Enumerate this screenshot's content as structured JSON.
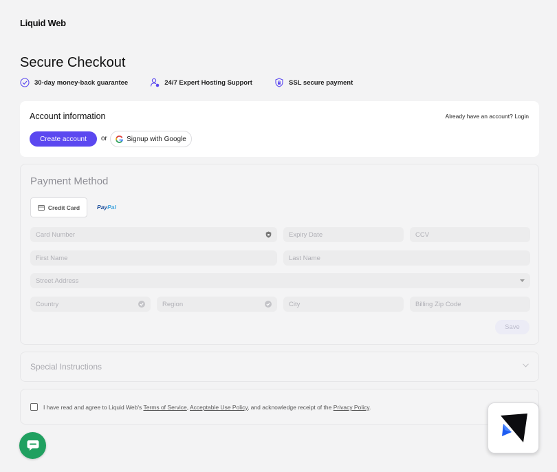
{
  "brand": {
    "logo": "Liquid Web"
  },
  "page": {
    "title": "Secure Checkout"
  },
  "badges": [
    {
      "icon": "check-circle-icon",
      "label": "30-day money-back guarantee"
    },
    {
      "icon": "support-agent-icon",
      "label": "24/7 Expert Hosting Support"
    },
    {
      "icon": "shield-lock-icon",
      "label": "SSL secure payment"
    }
  ],
  "account": {
    "title": "Account information",
    "login_prompt": "Already have an account? Login",
    "create_label": "Create account",
    "or_text": "or",
    "google_label": "Signup with Google"
  },
  "payment": {
    "title": "Payment Method",
    "tabs": {
      "credit_card": "Credit Card",
      "paypal_a": "Pay",
      "paypal_b": "Pal"
    },
    "placeholders": {
      "card_number": "Card Number",
      "expiry": "Expiry Date",
      "ccv": "CCV",
      "first_name": "First Name",
      "last_name": "Last Name",
      "street": "Street Address",
      "country": "Country",
      "region": "Region",
      "city": "City",
      "zip": "Billing Zip Code"
    },
    "save_label": "Save"
  },
  "special": {
    "title": "Special Instructions"
  },
  "terms": {
    "prefix": "I have read and agree to Liquid Web's ",
    "tos": "Terms of Service",
    "sep1": ", ",
    "aup": "Acceptable Use Policy",
    "mid": ", and acknowledge receipt of the ",
    "privacy": "Privacy Policy",
    "suffix": "."
  },
  "colors": {
    "accent": "#5b48f0",
    "chat": "#20a060",
    "paypal_dark": "#1f78c8",
    "paypal_light": "#3fa3dd"
  }
}
